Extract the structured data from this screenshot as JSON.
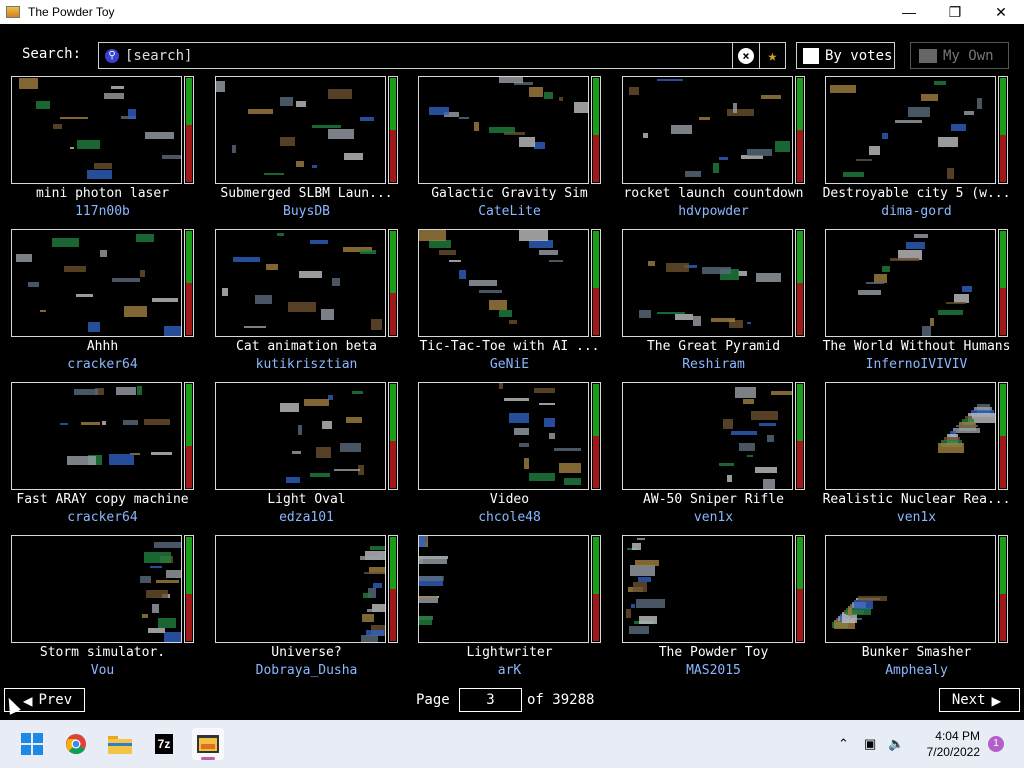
{
  "window": {
    "title": "The Powder Toy"
  },
  "search": {
    "label": "Search:",
    "placeholder": "[search]",
    "value": ""
  },
  "toolbar": {
    "sort_label": "By votes",
    "own_label": "My Own"
  },
  "colors": {
    "vote_up": "#1a9e1a",
    "vote_down": "#a01818",
    "author": "#8ab8ff"
  },
  "saves": [
    {
      "title": "mini photon laser",
      "author": "117n00b",
      "up": 0.45
    },
    {
      "title": "Submerged SLBM Laun...",
      "author": "BuysDB",
      "up": 0.5
    },
    {
      "title": "Galactic Gravity Sim",
      "author": "CateLite",
      "up": 0.55
    },
    {
      "title": "rocket launch countdown",
      "author": "hdvpowder",
      "up": 0.5
    },
    {
      "title": "Destroyable city 5 (w...",
      "author": "dima-gord",
      "up": 0.55
    },
    {
      "title": "Ahhh",
      "author": "cracker64",
      "up": 0.5
    },
    {
      "title": "Cat animation  beta",
      "author": "kutikrisztian",
      "up": 0.6
    },
    {
      "title": "Tic-Tac-Toe with AI ...",
      "author": "GeNiE",
      "up": 0.55
    },
    {
      "title": "The Great Pyramid",
      "author": "Reshiram",
      "up": 0.5
    },
    {
      "title": "The World Without Humans",
      "author": "InfernoIVIVIV",
      "up": 0.55
    },
    {
      "title": "Fast ARAY copy machine",
      "author": "cracker64",
      "up": 0.6
    },
    {
      "title": "Light Oval",
      "author": "edza101",
      "up": 0.55
    },
    {
      "title": "Video",
      "author": "chcole48",
      "up": 0.5
    },
    {
      "title": "AW-50 Sniper Rifle",
      "author": "ven1x",
      "up": 0.55
    },
    {
      "title": "Realistic Nuclear Rea...",
      "author": "ven1x",
      "up": 0.5
    },
    {
      "title": "Storm simulator.",
      "author": "Vou",
      "up": 0.55
    },
    {
      "title": "Universe?",
      "author": "Dobraya_Dusha",
      "up": 0.5
    },
    {
      "title": "Lightwriter",
      "author": "arK",
      "up": 0.55
    },
    {
      "title": "The Powder Toy",
      "author": "MAS2015",
      "up": 0.5
    },
    {
      "title": "Bunker Smasher",
      "author": "Amphealy",
      "up": 0.55
    }
  ],
  "pagination": {
    "prev_label": "Prev",
    "next_label": "Next",
    "page_label": "Page",
    "current_page": "3",
    "of_label": "of 39288"
  },
  "taskbar": {
    "time": "4:04 PM",
    "date": "7/20/2022",
    "notifications": "1",
    "zip_label": "7z"
  }
}
